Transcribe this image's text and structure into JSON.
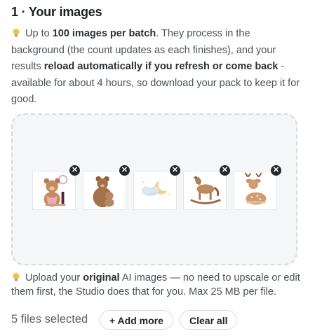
{
  "section": {
    "title": "1 · Your images"
  },
  "tip_batch": {
    "t1": "Up to ",
    "b1": "100 images per batch",
    "t2": ". They process in the background (the count updates as each finishes), and your results ",
    "b2": "reload automatically if you refresh or come back",
    "t3": " - available for about 4 hours, so download your pack to keep it for good."
  },
  "thumbnails": [
    {
      "subject": "teddy bear with wine",
      "remove_icon": "close-icon"
    },
    {
      "subject": "bear with cub",
      "remove_icon": "close-icon"
    },
    {
      "subject": "moon and clouds",
      "remove_icon": "close-icon"
    },
    {
      "subject": "rocking horse",
      "remove_icon": "close-icon"
    },
    {
      "subject": "baby deer",
      "remove_icon": "close-icon"
    }
  ],
  "tip_upload": {
    "t1": "Upload your ",
    "b1": "original",
    "t2": " AI images — no need to upscale or edit them first, the Studio does that for you. Max 25 MB per file."
  },
  "footer": {
    "files_selected": "5 files selected",
    "add_more": "+ Add more",
    "clear_all": "Clear all"
  },
  "colors": {
    "accent_bulb": "#f5c23a",
    "dropzone_bg": "#f5f6f7",
    "remove_badge": "#25282d"
  }
}
